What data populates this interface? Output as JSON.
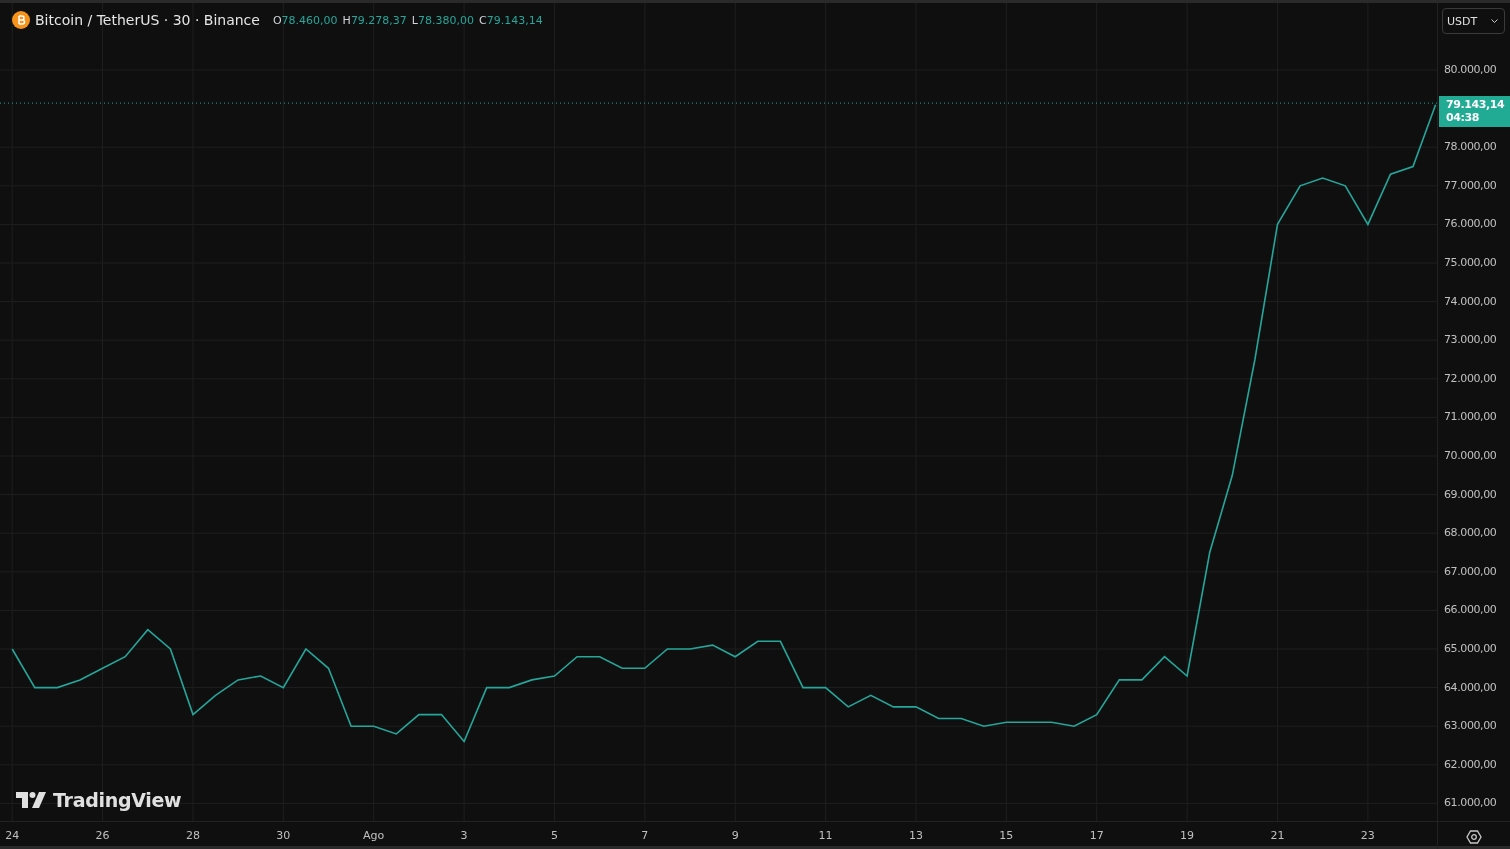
{
  "legend": {
    "symbol": "Bitcoin / TetherUS · 30 · Binance",
    "ohlc": [
      {
        "label": "O",
        "value": "78.460,00"
      },
      {
        "label": "H",
        "value": "79.278,37"
      },
      {
        "label": "L",
        "value": "78.380,00"
      },
      {
        "label": "C",
        "value": "79.143,14"
      }
    ]
  },
  "currency_selector": {
    "value": "USDT"
  },
  "price_label": {
    "price": "79.143,14",
    "countdown": "04:38"
  },
  "chart_data": {
    "type": "line",
    "categories": [
      "24",
      null,
      null,
      null,
      "26",
      null,
      null,
      null,
      "28",
      null,
      null,
      null,
      "30",
      null,
      null,
      null,
      "Ago",
      null,
      null,
      null,
      "3",
      null,
      null,
      null,
      "5",
      null,
      null,
      null,
      "7",
      null,
      null,
      null,
      "9",
      null,
      null,
      null,
      "11",
      null,
      null,
      null,
      "13",
      null,
      null,
      null,
      "15",
      null,
      null,
      null,
      "17",
      null,
      null,
      null,
      "19",
      null,
      null,
      null,
      "21",
      null,
      null,
      null,
      "23",
      null,
      null,
      null
    ],
    "series": [
      {
        "color": "#26a69a",
        "values": [
          65000,
          64000,
          64000,
          64200,
          64500,
          64800,
          65500,
          65000,
          63300,
          63800,
          64200,
          64300,
          64000,
          65000,
          64500,
          63000,
          63000,
          62800,
          63300,
          63300,
          62600,
          64000,
          64000,
          64200,
          64300,
          64800,
          64800,
          64500,
          64500,
          65000,
          65000,
          65100,
          64800,
          65200,
          65200,
          64000,
          64000,
          63500,
          63800,
          63500,
          63500,
          63200,
          63200,
          63000,
          63100,
          63100,
          63100,
          63000,
          63300,
          64200,
          64200,
          64800,
          64300,
          67500,
          69500,
          72500,
          76000,
          77000,
          77200,
          77000,
          76000,
          77300,
          77500,
          79100
        ]
      }
    ],
    "grid": true,
    "ref_lines": [
      {
        "axis": "y",
        "value": 79143,
        "color": "#26a69a"
      }
    ],
    "ylim": [
      60544,
      81736
    ],
    "yticks": [
      {
        "value": 61000,
        "label": "61.000,00"
      },
      {
        "value": 62000,
        "label": "62.000,00"
      },
      {
        "value": 63000,
        "label": "63.000,00"
      },
      {
        "value": 64000,
        "label": "64.000,00"
      },
      {
        "value": 65000,
        "label": "65.000,00"
      },
      {
        "value": 66000,
        "label": "66.000,00"
      },
      {
        "value": 67000,
        "label": "67.000,00"
      },
      {
        "value": 68000,
        "label": "68.000,00"
      },
      {
        "value": 69000,
        "label": "69.000,00"
      },
      {
        "value": 70000,
        "label": "70.000,00"
      },
      {
        "value": 71000,
        "label": "71.000,00"
      },
      {
        "value": 72000,
        "label": "72.000,00"
      },
      {
        "value": 73000,
        "label": "73.000,00"
      },
      {
        "value": 74000,
        "label": "74.000,00"
      },
      {
        "value": 75000,
        "label": "75.000,00"
      },
      {
        "value": 76000,
        "label": "76.000,00"
      },
      {
        "value": 77000,
        "label": "77.000,00"
      },
      {
        "value": 78000,
        "label": "78.000,00"
      },
      {
        "value": 80000,
        "label": "80.000,00"
      }
    ]
  },
  "logo": {
    "text": "TradingView"
  }
}
